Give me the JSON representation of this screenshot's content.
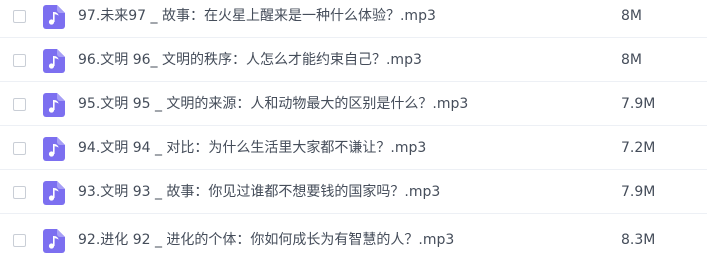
{
  "icon_color": "#7c6ff0",
  "files": [
    {
      "icon": "music-note-icon",
      "name": "97.未来97 _ 故事：在火星上醒来是一种什么体验？.mp3",
      "size": "8M"
    },
    {
      "icon": "music-note-icon",
      "name": "96.文明 96_ 文明的秩序：人怎么才能约束自己？.mp3",
      "size": "8M"
    },
    {
      "icon": "music-note-icon",
      "name": "95.文明 95 _ 文明的来源：人和动物最大的区别是什么？.mp3",
      "size": "7.9M"
    },
    {
      "icon": "music-note-icon",
      "name": "94.文明 94 _ 对比：为什么生活里大家都不谦让？.mp3",
      "size": "7.2M"
    },
    {
      "icon": "music-note-icon",
      "name": "93.文明 93 _ 故事：你见过谁都不想要钱的国家吗？.mp3",
      "size": "7.9M"
    },
    {
      "icon": "music-note-icon",
      "name": "92.进化 92 _ 进化的个体：你如何成长为有智慧的人？.mp3",
      "size": "8.3M"
    }
  ]
}
